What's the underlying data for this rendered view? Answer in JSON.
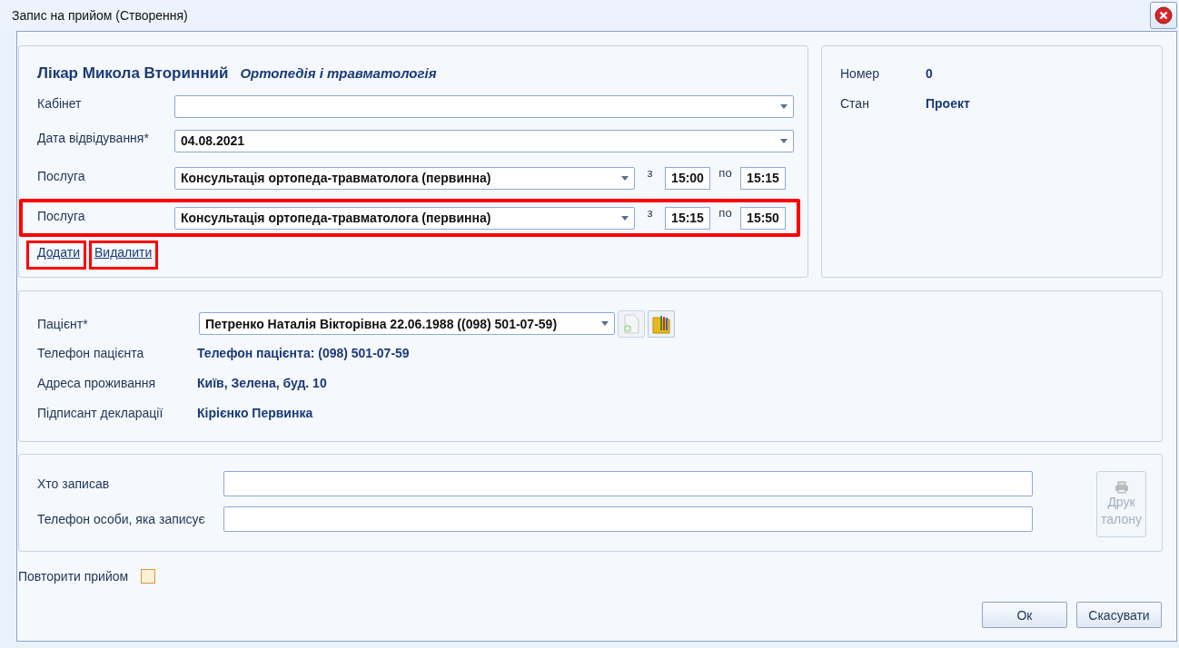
{
  "window": {
    "title": "Запис на прийом (Створення)"
  },
  "appointment": {
    "doctor": "Лікар Микола Вторинний",
    "specialty": "Ортопедія і травматологія",
    "fields": [
      {
        "label": "Кабінет"
      },
      {
        "label": "Дата відвідування*",
        "value": "04.08.2021"
      }
    ],
    "services": [
      {
        "label": "Послуга",
        "value": "Консультація ортопеда-травматолога (первинна)",
        "from_label": "з",
        "from": "15:00",
        "to_label": "по",
        "to": "15:15",
        "highlighted": false
      },
      {
        "label": "Послуга",
        "value": "Консультація ортопеда-травматолога (первинна)",
        "from_label": "з",
        "from": "15:15",
        "to_label": "по",
        "to": "15:50",
        "highlighted": true
      }
    ],
    "links": [
      {
        "label": "Додати",
        "highlighted": true
      },
      {
        "label": "Видалити",
        "highlighted": true
      }
    ]
  },
  "info": [
    {
      "label": "Номер",
      "value": "0"
    },
    {
      "label": "Стан",
      "value": "Проект"
    }
  ],
  "patient": {
    "label": "Пацієнт*",
    "value": "Петренко Наталія Вікторівна 22.06.1988 ((098) 501-07-59)",
    "details": [
      {
        "label": "Телефон пацієнта",
        "value": "Телефон пацієнта: (098) 501-07-59"
      },
      {
        "label": "Адреса проживання",
        "value": "Київ, Зелена, буд. 10"
      },
      {
        "label": "Підписант декларації",
        "value": "Кірієнко Первинка"
      }
    ]
  },
  "recorder": {
    "fields": [
      {
        "label": "Хто записав"
      },
      {
        "label": "Телефон особи, яка записує"
      }
    ],
    "print_button": {
      "label": "Друк талону",
      "disabled": true
    }
  },
  "repeat": {
    "label": "Повторити прийом",
    "checked": false
  },
  "buttons": [
    "Ок",
    "Скасувати"
  ]
}
